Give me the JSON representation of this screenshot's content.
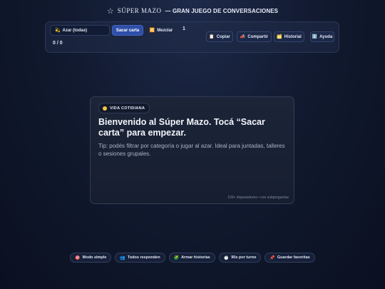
{
  "header": {
    "star_icon": "☆",
    "brand": "SÚPER MAZO",
    "tagline": "— GRAN JUEGO DE CONVERSACIONES"
  },
  "toolbar": {
    "category_select": {
      "icon": "💫",
      "value": "Azar (todas)"
    },
    "draw_button": "Sacar carta",
    "shuffle_button": {
      "icon": "🔀",
      "label": "Mezclar"
    },
    "counter": "1",
    "score": "0 / 0",
    "actions": [
      {
        "name": "copy",
        "icon": "📋",
        "label": "Copiar"
      },
      {
        "name": "share",
        "icon": "📣",
        "label": "Compartir"
      },
      {
        "name": "history",
        "icon": "🗂️",
        "label": "Historial"
      },
      {
        "name": "help",
        "icon": "ℹ️",
        "label": "Ayuda"
      }
    ]
  },
  "card": {
    "category": "VIDA COTIDIANA",
    "category_color": "#f5c542",
    "title": "Bienvenido al Súper Mazo. Tocá “Sacar carta” para empezar.",
    "tip": "Tip: podés filtrar por categoría o jugar al azar. Ideal para juntadas, talleres o sesiones grupales.",
    "footer": "100+ disparadores • con subpreguntas"
  },
  "features": [
    {
      "icon": "🎯",
      "label": "Modo simple"
    },
    {
      "icon": "👥",
      "label": "Todos responden"
    },
    {
      "icon": "🧩",
      "label": "Armar historias"
    },
    {
      "icon": "⏱️",
      "label": "90s por turno"
    },
    {
      "icon": "📌",
      "label": "Guardar favoritas"
    }
  ],
  "colors": {
    "accent": "#2e4ea8",
    "background": "#111a30",
    "card": "#1a2236"
  }
}
